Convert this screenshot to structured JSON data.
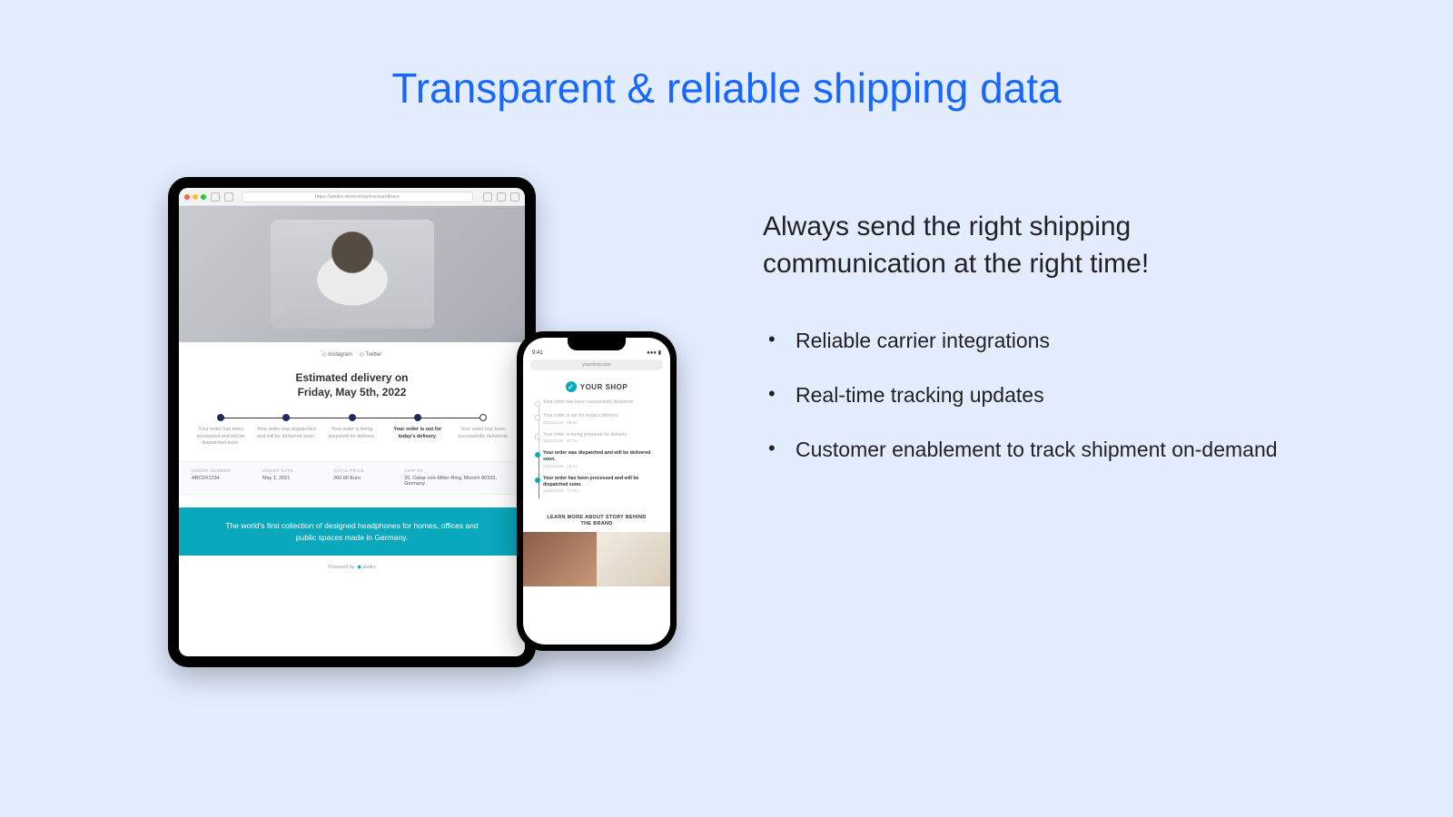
{
  "title": "Transparent & reliable shipping data",
  "subhead": "Always send the right shipping communication at the right time!",
  "bullets": [
    "Reliable carrier integrations",
    "Real-time tracking updates",
    "Customer enablement to track shipment on-demand"
  ],
  "tablet": {
    "url": "https://alaiko-demoshop/trackandtrace",
    "socials": {
      "instagram": "Instagram",
      "twitter": "Twitter"
    },
    "estimated_line1": "Estimated delivery on",
    "estimated_line2": "Friday, May 5th, 2022",
    "steps": [
      {
        "label": "Your order has been processed and will be dispatched soon.",
        "done": true
      },
      {
        "label": "Your order was dispatched and will be delivered soon.",
        "done": true
      },
      {
        "label": "Your order is being prepared for delivery.",
        "done": true
      },
      {
        "label": "Your order is out for today's delivery.",
        "done": true,
        "active": true
      },
      {
        "label": "Your order has been successfully delivered.",
        "done": false
      }
    ],
    "order": {
      "number_label": "ORDER NUMBER",
      "number": "ABCD#1234",
      "date_label": "ORDER DATE",
      "date": "May 1, 2021",
      "total_label": "TOTAL PRICE",
      "total": "260.00 Euro",
      "ship_label": "SHIP TO",
      "ship": "20, Oskar-von-Miller-Ring, Munich 80333, Germany"
    },
    "banner": "The world's first collection of designed headphones for homes, offices and public spaces made in Germany.",
    "powered_by_prefix": "Powered by",
    "powered_by_brand": "alaiko"
  },
  "phone": {
    "time": "9:41",
    "url": "yourshop.com",
    "brand": "YOUR SHOP",
    "items": [
      {
        "text": "Your order has been successfully delivered.",
        "date": "",
        "on": false
      },
      {
        "text": "Your order is out for today's delivery.",
        "date": "2021/11/29  ·  09:30",
        "on": false
      },
      {
        "text": "Your order is being prepared for delivery.",
        "date": "2021/11/30  ·  07:03",
        "on": false
      },
      {
        "text": "Your order was dispatched and will be delivered soon.",
        "date": "2021/11/29  ·  19:31",
        "on": true
      },
      {
        "text": "Your order has been processed and will be dispatched soon.",
        "date": "2021/11/29  ·  17:03",
        "on": true
      }
    ],
    "more": "LEARN MORE ABOUT STORY BEHIND THE BRAND"
  }
}
